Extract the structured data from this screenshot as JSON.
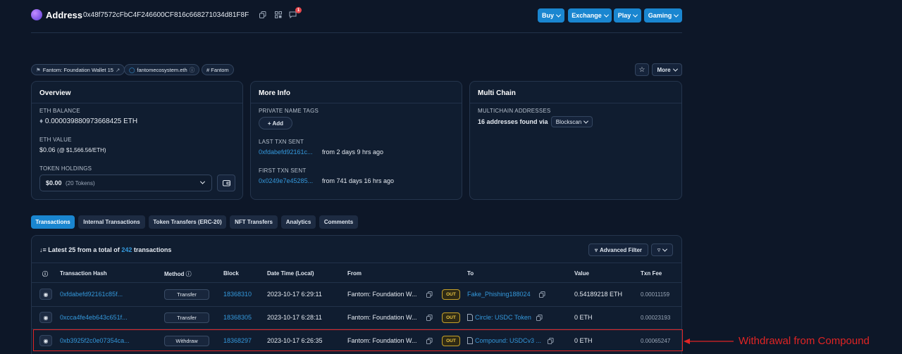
{
  "header": {
    "title": "Address",
    "address": "0x48f7572cFbC4F246600CF816c668271034d81F8F",
    "notif_count": "1",
    "buttons": [
      "Buy",
      "Exchange",
      "Play",
      "Gaming"
    ]
  },
  "tags": {
    "wallet": "Fantom: Foundation Wallet 15",
    "ens": "fantomecosystem.eth",
    "chain": "# Fantom",
    "more": "More"
  },
  "overview": {
    "title": "Overview",
    "eth_balance_label": "ETH BALANCE",
    "eth_balance": "0.000039880973668425 ETH",
    "eth_value_label": "ETH VALUE",
    "eth_value": "$0.06",
    "eth_price": "(@ $1,566.56/ETH)",
    "token_label": "TOKEN HOLDINGS",
    "token_value": "$0.00",
    "token_count": "(20 Tokens)"
  },
  "more_info": {
    "title": "More Info",
    "tags_label": "PRIVATE NAME TAGS",
    "add_label": "+ Add",
    "last_label": "LAST TXN SENT",
    "last_hash": "0xfdabefd92161c...",
    "last_time": "from 2 days 9 hrs ago",
    "first_label": "FIRST TXN SENT",
    "first_hash": "0x0249e7e45285...",
    "first_time": "from 741 days 16 hrs ago"
  },
  "multichain": {
    "title": "Multi Chain",
    "label": "MULTICHAIN ADDRESSES",
    "text": "16 addresses found via",
    "dropdown": "Blockscan"
  },
  "tabs": [
    "Transactions",
    "Internal Transactions",
    "Token Transfers (ERC-20)",
    "NFT Transfers",
    "Analytics",
    "Comments"
  ],
  "table": {
    "summary_prefix": "Latest 25 from a total of",
    "summary_count": "242",
    "summary_suffix": "transactions",
    "adv_filter": "Advanced Filter",
    "headers": {
      "hash": "Transaction Hash",
      "method": "Method",
      "block": "Block",
      "datetime": "Date Time (Local)",
      "from": "From",
      "to": "To",
      "value": "Value",
      "fee": "Txn Fee"
    },
    "rows": [
      {
        "hash": "0xfdabefd92161c85f...",
        "method": "Transfer",
        "block": "18368310",
        "datetime": "2023-10-17 6:29:11",
        "from": "Fantom: Foundation W...",
        "dir": "OUT",
        "to": "Fake_Phishing188024",
        "value": "0.54189218 ETH",
        "fee": "0.00011159"
      },
      {
        "hash": "0xcca4fe4eb643c651f...",
        "method": "Transfer",
        "block": "18368305",
        "datetime": "2023-10-17 6:28:11",
        "from": "Fantom: Foundation W...",
        "dir": "OUT",
        "to": "Circle: USDC Token",
        "value": "0 ETH",
        "fee": "0.00023193"
      },
      {
        "hash": "0xb3925f2c0e07354ca...",
        "method": "Withdraw",
        "block": "18368297",
        "datetime": "2023-10-17 6:26:35",
        "from": "Fantom: Foundation W...",
        "dir": "OUT",
        "to": "Compound: USDCv3 ...",
        "value": "0 ETH",
        "fee": "0.00065247"
      }
    ]
  },
  "annotation": {
    "text": "Withdrawal from Compound",
    "color": "#e02424"
  },
  "colors": {
    "background": "#0d1728",
    "accent": "#1a86d0",
    "link": "#3498db",
    "out_badge": "#e8c340"
  }
}
